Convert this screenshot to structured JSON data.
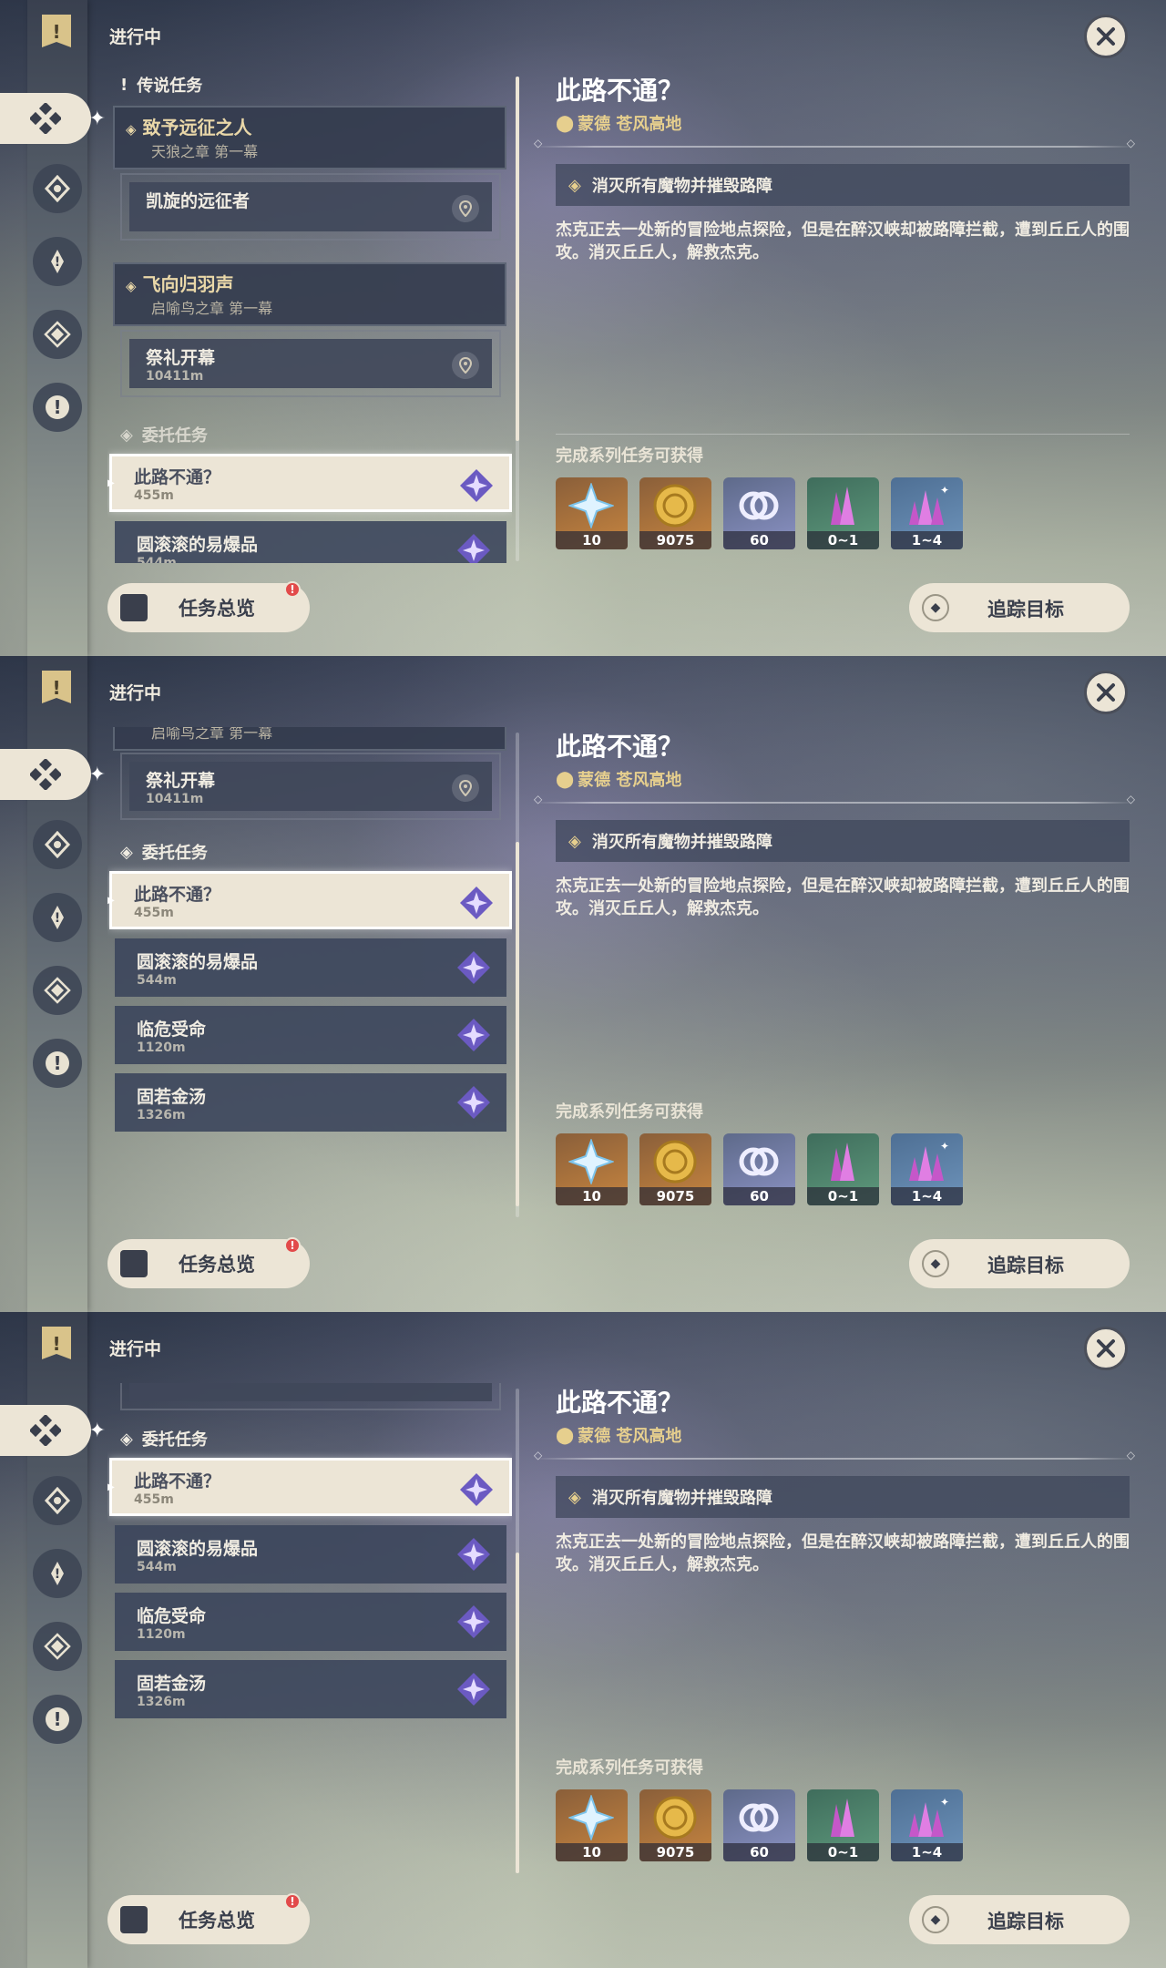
{
  "header": {
    "label": "进行中"
  },
  "sections": {
    "legend": "传说任务",
    "commission": "委托任务"
  },
  "archon": [
    {
      "title": "致予远征之人",
      "chapter": "天狼之章 第一幕",
      "sub_title": "凯旋的远征者"
    },
    {
      "title": "飞向归羽声",
      "chapter": "启喻鸟之章 第一幕",
      "sub_title": "祭礼开幕",
      "sub_dist": "10411m"
    }
  ],
  "commissions": [
    {
      "title": "此路不通？",
      "dist": "455m"
    },
    {
      "title": "圆滚滚的易爆品",
      "dist": "544m"
    },
    {
      "title": "临危受命",
      "dist": "1120m"
    },
    {
      "title": "固若金汤",
      "dist": "1326m"
    }
  ],
  "detail": {
    "title": "此路不通？",
    "location": "蒙德 苍风高地",
    "objective": "消灭所有魔物并摧毁路障",
    "description": "杰克正去一处新的冒险地点探险，但是在醉汉峡却被路障拦截，遭到丘丘人的围攻。消灭丘丘人，解救杰克。",
    "rewards_label": "完成系列任务可获得",
    "rewards": [
      {
        "icon": "primogem-icon",
        "qty": "10"
      },
      {
        "icon": "mora-icon",
        "qty": "9075"
      },
      {
        "icon": "adventure-exp-icon",
        "qty": "60"
      },
      {
        "icon": "crystal-icon",
        "qty": "0~1"
      },
      {
        "icon": "crystal-cluster-icon",
        "qty": "1~4"
      }
    ]
  },
  "buttons": {
    "overview": "任务总览",
    "overview_badge": "!",
    "track": "追踪目标"
  },
  "colors": {
    "gold": "#e6cf8e",
    "cream": "#ece5d6",
    "alert": "#e24a4a"
  }
}
